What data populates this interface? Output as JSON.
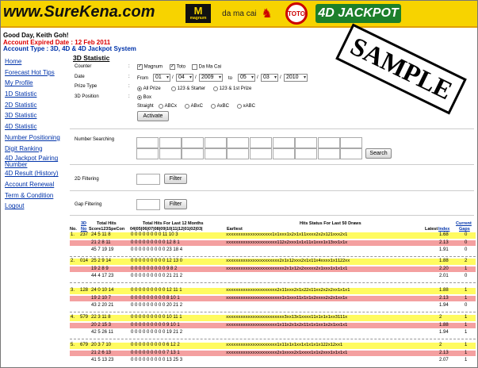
{
  "banner": {
    "site_name": "www.SureKena.com",
    "magnum": "magnum",
    "magnum_letter": "M",
    "damacai": "da ma cai",
    "toto": "TOTO",
    "jackpot": "4D JACKPOT"
  },
  "account": {
    "greeting": "Good Day, Keith Goh!",
    "expiry": "Account Expired Date : 12 Feb 2011",
    "type": "Account Type : 3D, 4D & 4D Jackpot System"
  },
  "sidebar": {
    "items": [
      "Home",
      "Forecast Hot Tips",
      "My Profile",
      "1D Statistic",
      "2D Statistic",
      "3D Statistic",
      "4D Statistic",
      "Number Positioning",
      "Digit Ranking",
      "4D Jackpot Pairing Number",
      "4D Result (History)",
      "Account Renewal",
      "Term & Condition",
      "Logout"
    ]
  },
  "form": {
    "title": "3D Statistic",
    "counter_label": "Counter",
    "counter_options": [
      {
        "label": "Magnum",
        "checked": true
      },
      {
        "label": "Toto",
        "checked": true
      },
      {
        "label": "Da Ma Cai",
        "checked": false
      }
    ],
    "date_label": "Date",
    "from_label": "From",
    "to_label": "to",
    "from": {
      "day": "01",
      "month": "04",
      "year": "2009"
    },
    "to": {
      "day": "05",
      "month": "03",
      "year": "2010"
    },
    "prize_label": "Prize Type",
    "prize_options": [
      "All Prize",
      "123 & Starter",
      "123 & 1st Prize"
    ],
    "position_label": "3D Position",
    "position_box": "Box",
    "straight_label": "Straight",
    "straight_options": [
      "ABCx",
      "ABxC",
      "AxBC",
      "xABC"
    ],
    "activate": "Activate",
    "search_label": "Number Searching",
    "search_button": "Search",
    "filter2d_label": "2D Filtering",
    "gap_label": "Gap Filtering",
    "filter_button": "Filter",
    "stamp": "SAMPLE"
  },
  "table": {
    "headers": {
      "no": "No.",
      "d3": "3D",
      "d3_no": "No",
      "total_hits": "Total Hits",
      "score": "Score123SpeCon",
      "hits12": "Total Hits For Last 12 Months",
      "months": "04|05|06|07|08|09|10|11|12|01|02|03|",
      "status": "Hits Status For Last 50 Draws",
      "earliest": "Earliest",
      "latest": "Latest",
      "index": "Index",
      "current": "Current",
      "gaps": "Gaps"
    },
    "groups": [
      {
        "no": "1.",
        "num": "237",
        "rows": [
          {
            "hits": "24  5  11  8",
            "months": "0  0  0  0  0  0  0  0  11  10  3",
            "status": "xxxxxxxxxxxxxxxxxxx1x1xxx1x2x1x11xxxx2x2x121xxx2x1",
            "idx": "1.68",
            "gap": "0"
          },
          {
            "hits": "21  2  8  11",
            "months": "0  0  0  0  0  0  0  0  0  12  8  1",
            "status": "xxxxxxxxxxxxxxxxxxxxx112x2xxx1x1x11x1xxx1x13xx1x1x",
            "idx": "2.13",
            "gap": "0"
          },
          {
            "hits": "45  7  19  19",
            "months": "0  0  0  0  0  0  0  0  0  23  18  4",
            "status": "",
            "idx": "1.91",
            "gap": "0"
          }
        ]
      },
      {
        "no": "2.",
        "num": "014",
        "rows": [
          {
            "hits": "25  2  9  14",
            "months": "0  0  0  0  0  0  0  0  0  12  13  0",
            "status": "xxxxxxxxxxxxxxxxxxxxxx2x1x12xxx2x1x11x4xxxx1x1122xx",
            "idx": "1.88",
            "gap": "2"
          },
          {
            "hits": "19  2  8  9",
            "months": "0  0  0  0  0  0  0  0  0  9  8  2",
            "status": "xxxxxxxxxxxxxxxxxxxxxxxx2x1x12x2xxxxx2x1xxx1x1x1x1",
            "idx": "2.20",
            "gap": "1"
          },
          {
            "hits": "44  4  17  23",
            "months": "0  0  0  0  0  0  0  0  0  21  21  2",
            "status": "",
            "idx": "2.01",
            "gap": "0"
          }
        ]
      },
      {
        "no": "3.",
        "num": "128",
        "rows": [
          {
            "hits": "24  0  10  14",
            "months": "0  0  0  0  0  0  0  0  0  12  11  1",
            "status": "xxxxxxxxxxxxxxxxxxxxx2x11xxx2x1x22x11xx2x2x2xx1x1x1",
            "idx": "1.88",
            "gap": "1"
          },
          {
            "hits": "19  2  10  7",
            "months": "0  0  0  0  0  0  0  0  0  8  10  1",
            "status": "xxxxxxxxxxxxxxxxxxxxxxx1x1xxx11x1x1x2xxxx2x2x1xx1x",
            "idx": "2.13",
            "gap": "1"
          },
          {
            "hits": "43  2  20  21",
            "months": "0  0  0  0  0  0  0  0  0  20  21  2",
            "status": "",
            "idx": "1.94",
            "gap": "0"
          }
        ]
      },
      {
        "no": "4.",
        "num": "579",
        "rows": [
          {
            "hits": "22  3  11  8",
            "months": "0  0  0  0  0  0  0  0  0  10  11  1",
            "status": "xxxxxxxxxxxxxxxxxxxxxxxx3xx13x1xxxx11x1x1x1xx3111x",
            "idx": "2",
            "gap": "1"
          },
          {
            "hits": "20  2  15  3",
            "months": "0  0  0  0  0  0  0  0  0  9  10  1",
            "status": "xxxxxxxxxxxxxxxxxxxxx1x11x2x1x2x11x1x1xx1x2x1xx1x1",
            "idx": "1.88",
            "gap": "1"
          },
          {
            "hits": "42  5  26  11",
            "months": "0  0  0  0  0  0  0  0  0  19  21  2",
            "status": "",
            "idx": "1.94",
            "gap": "1"
          }
        ]
      },
      {
        "no": "5.",
        "num": "679",
        "rows": [
          {
            "hits": "20  3  7  10",
            "months": "0  0  0  0  0  0  0  0  0  6  12  2",
            "status": "xxxxxxxxxxxxxxxxxxxxx1x11x1x1xx1x1x1x1x122x12xx1",
            "idx": "2",
            "gap": "1"
          },
          {
            "hits": "21  2  6  13",
            "months": "0  0  0  0  0  0  0  0  0  7  13  1",
            "status": "xxxxxxxxxxxxxxxxxxxxx2x1xxxx2x1xxxx1x1x2xxx1x1x1x1",
            "idx": "2.13",
            "gap": "1"
          },
          {
            "hits": "41  5  13  23",
            "months": "0  0  0  0  0  0  0  0  0  13  25  3",
            "status": "",
            "idx": "2.07",
            "gap": "1"
          }
        ]
      }
    ]
  }
}
